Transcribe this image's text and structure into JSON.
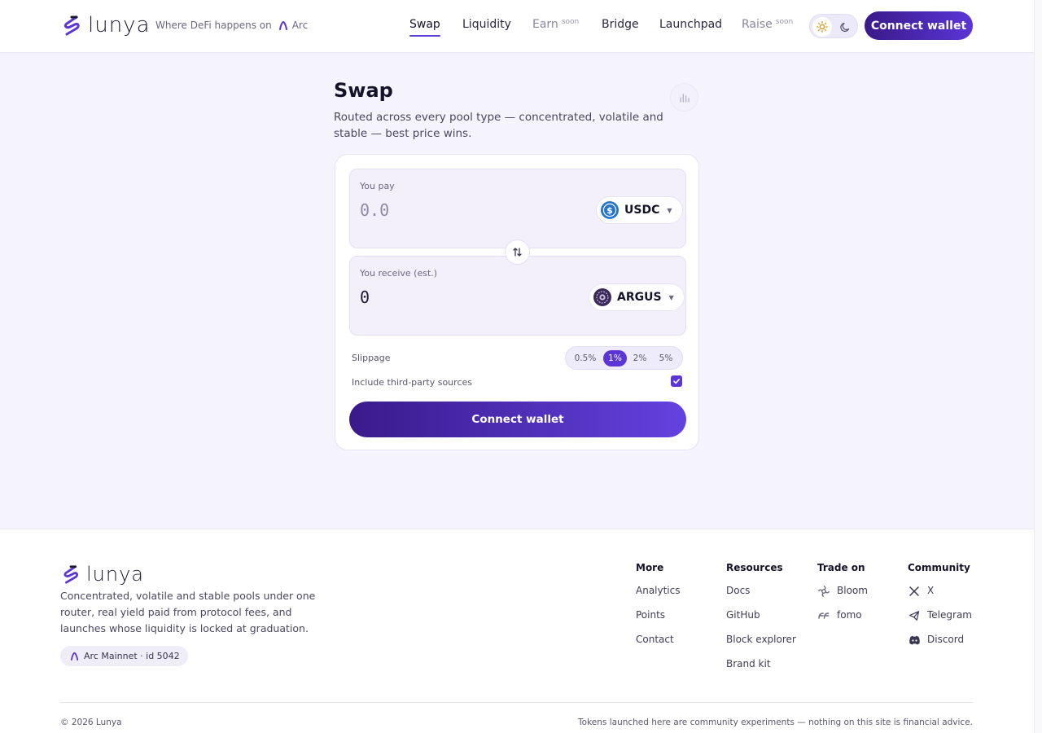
{
  "colors": {
    "accent": "#5b35d6",
    "accent_dark": "#3a1a8a",
    "background": "#f5f4fd",
    "panel": "#f3f0fc"
  },
  "header": {
    "brand": "lunya",
    "tagline": "Where DeFi happens on",
    "chain": "Arc",
    "nav": [
      {
        "label": "Swap",
        "active": true
      },
      {
        "label": "Liquidity"
      },
      {
        "label": "Earn",
        "badge": "soon"
      },
      {
        "label": "Bridge"
      },
      {
        "label": "Launchpad"
      },
      {
        "label": "Raise",
        "badge": "soon"
      }
    ],
    "theme_icons": [
      "sun-icon",
      "moon-icon"
    ],
    "connect_label": "Connect wallet"
  },
  "swap": {
    "title": "Swap",
    "subtitle": "Routed across every pool type — concentrated, volatile and stable — best price wins.",
    "pay": {
      "label": "You pay",
      "placeholder": "0.0",
      "token": "USDC"
    },
    "receive": {
      "label": "You receive (est.)",
      "value": "0",
      "token": "ARGUS"
    },
    "slippage": {
      "label": "Slippage",
      "options": [
        "0.5%",
        "1%",
        "2%",
        "5%"
      ],
      "selected": "1%"
    },
    "third_party": {
      "label": "Include third-party sources",
      "checked": true
    },
    "connect_label": "Connect wallet"
  },
  "footer": {
    "brand": "lunya",
    "description": "Concentrated, volatile and stable pools under one router, real yield paid from protocol fees, and launches whose liquidity is locked at graduation.",
    "network_badge": "Arc Mainnet · id 5042",
    "columns": [
      {
        "title": "More",
        "links": [
          "Analytics",
          "Points",
          "Contact"
        ]
      },
      {
        "title": "Resources",
        "links": [
          "Docs",
          "GitHub",
          "Block explorer",
          "Brand kit"
        ]
      },
      {
        "title": "Trade on",
        "links": [
          "Bloom",
          "fomo"
        ]
      },
      {
        "title": "Community",
        "links": [
          "X",
          "Telegram",
          "Discord"
        ]
      }
    ],
    "copyright": "© 2026 Lunya",
    "disclaimer": "Tokens launched here are community experiments — nothing on this site is financial advice."
  }
}
